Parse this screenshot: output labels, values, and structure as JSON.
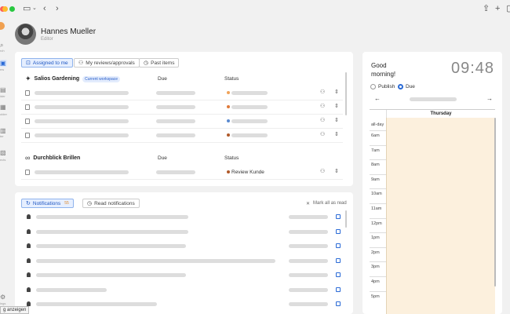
{
  "user": {
    "name": "Hannes Mueller",
    "role": "Editor"
  },
  "rail": {
    "items": [
      {
        "label": "rch"
      },
      {
        "label": "ew"
      },
      {
        "label": "ider"
      },
      {
        "label": "older"
      },
      {
        "label": "ter"
      },
      {
        "label": "ects"
      },
      {
        "label": "ings"
      }
    ]
  },
  "tooltip": "g anzeigen",
  "tasks": {
    "tabs": [
      {
        "label": "Assigned to me",
        "icon": "inbox-icon"
      },
      {
        "label": "My reviews/approvals",
        "icon": "users-icon"
      },
      {
        "label": "Past items",
        "icon": "clock-icon"
      }
    ],
    "columns": {
      "due": "Due",
      "status": "Status"
    },
    "workspaces": [
      {
        "name": "Salios Gardening",
        "badge": "Current workspace",
        "rows": [
          {
            "status_color": "#f0a35a",
            "status": ""
          },
          {
            "status_color": "#e07a3a",
            "status": ""
          },
          {
            "status_color": "#5a8ad0",
            "status": ""
          },
          {
            "status_color": "#b05a2a",
            "status": ""
          }
        ]
      },
      {
        "name": "Durchblick Brillen",
        "badge": "",
        "rows": [
          {
            "status_color": "#b05a2a",
            "status": "Review Kunde"
          }
        ]
      }
    ]
  },
  "notifications": {
    "tabs": [
      {
        "label": "Notifications",
        "count": "55"
      },
      {
        "label": "Read notifications"
      }
    ],
    "mark_all": "Mark all as read",
    "rows": [
      {
        "text_fraction": 0.58
      },
      {
        "text_fraction": 0.58
      },
      {
        "text_fraction": 0.57
      },
      {
        "text_fraction": 0.91
      },
      {
        "text_fraction": 0.57
      },
      {
        "text_fraction": 0.27
      },
      {
        "text_fraction": 0.46
      },
      {
        "text_fraction": 0.29
      }
    ]
  },
  "calendar": {
    "greeting_line1": "Good",
    "greeting_line2": "morning!",
    "time": "09:48",
    "mode_options": [
      {
        "label": "Publish",
        "selected": false
      },
      {
        "label": "Due",
        "selected": true
      }
    ],
    "prev": "←",
    "next": "→",
    "day": "Thursday",
    "allday": "all-day",
    "hours": [
      "6am",
      "7am",
      "8am",
      "9am",
      "10am",
      "11am",
      "12pm",
      "1pm",
      "2pm",
      "3pm",
      "4pm",
      "5pm"
    ]
  },
  "chrome": {
    "back": "‹",
    "forward": "›"
  }
}
